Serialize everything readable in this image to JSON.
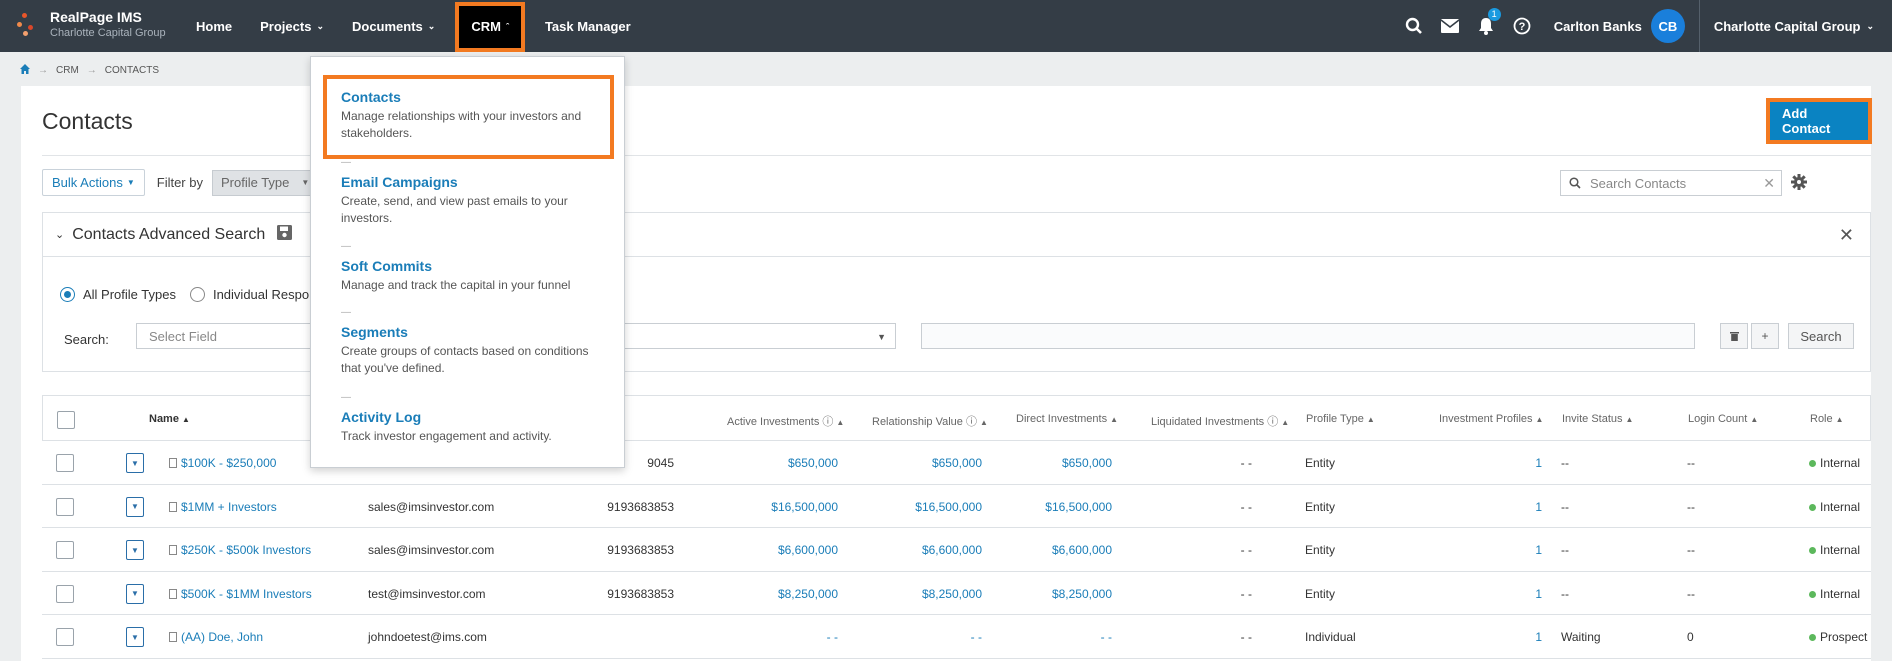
{
  "app": {
    "name": "RealPage IMS",
    "org_sub": "Charlotte Capital Group"
  },
  "nav": {
    "home": "Home",
    "projects": "Projects",
    "documents": "Documents",
    "crm": "CRM",
    "task_manager": "Task Manager"
  },
  "header_right": {
    "notification_count": "1",
    "user_name": "Carlton Banks",
    "avatar_initials": "CB",
    "org_name": "Charlotte Capital Group"
  },
  "breadcrumb": {
    "crm": "CRM",
    "contacts": "CONTACTS"
  },
  "page": {
    "title": "Contacts",
    "add_button": "Add Contact"
  },
  "toolbar": {
    "bulk_actions": "Bulk Actions",
    "filter_by": "Filter by",
    "profile_type": "Profile Type",
    "search_placeholder": "Search Contacts"
  },
  "advanced_search": {
    "title": "Contacts Advanced Search",
    "radio_all": "All Profile Types",
    "radio_individual": "Individual Respo",
    "search_label": "Search:",
    "select_field": "Select Field",
    "search_button": "Search"
  },
  "crm_menu": [
    {
      "title": "Contacts",
      "desc": "Manage relationships with your investors and stakeholders."
    },
    {
      "title": "Email Campaigns",
      "desc": "Create, send, and view past emails to your investors."
    },
    {
      "title": "Soft Commits",
      "desc": "Manage and track the capital in your funnel"
    },
    {
      "title": "Segments",
      "desc": "Create groups of contacts based on conditions that you've defined."
    },
    {
      "title": "Activity Log",
      "desc": "Track investor engagement and activity."
    }
  ],
  "table": {
    "headers": {
      "name": "Name",
      "active_investments": "Active Investments",
      "relationship_value": "Relationship Value",
      "direct_investments": "Direct Investments",
      "liquidated_investments": "Liquidated Investments",
      "profile_type": "Profile Type",
      "investment_profiles": "Investment Profiles",
      "invite_status": "Invite Status",
      "login_count": "Login Count",
      "role": "Role"
    },
    "rows": [
      {
        "name": "$100K - $250,000",
        "email": "",
        "phone": "9045",
        "active": "$650,000",
        "relationship": "$650,000",
        "direct": "$650,000",
        "liquidated": "- -",
        "profile_type": "Entity",
        "profiles": "1",
        "invite": "--",
        "login": "--",
        "role": "Internal"
      },
      {
        "name": "$1MM + Investors",
        "email": "sales@imsinvestor.com",
        "phone": "9193683853",
        "active": "$16,500,000",
        "relationship": "$16,500,000",
        "direct": "$16,500,000",
        "liquidated": "- -",
        "profile_type": "Entity",
        "profiles": "1",
        "invite": "--",
        "login": "--",
        "role": "Internal"
      },
      {
        "name": "$250K - $500k Investors",
        "email": "sales@imsinvestor.com",
        "phone": "9193683853",
        "active": "$6,600,000",
        "relationship": "$6,600,000",
        "direct": "$6,600,000",
        "liquidated": "- -",
        "profile_type": "Entity",
        "profiles": "1",
        "invite": "--",
        "login": "--",
        "role": "Internal"
      },
      {
        "name": "$500K - $1MM Investors",
        "email": "test@imsinvestor.com",
        "phone": "9193683853",
        "active": "$8,250,000",
        "relationship": "$8,250,000",
        "direct": "$8,250,000",
        "liquidated": "- -",
        "profile_type": "Entity",
        "profiles": "1",
        "invite": "--",
        "login": "--",
        "role": "Internal"
      },
      {
        "name": "(AA) Doe, John",
        "email": "johndoetest@ims.com",
        "phone": "",
        "active": "- -",
        "relationship": "- -",
        "direct": "- -",
        "liquidated": "- -",
        "profile_type": "Individual",
        "profiles": "1",
        "invite": "Waiting",
        "login": "0",
        "role": "Prospect"
      }
    ]
  }
}
